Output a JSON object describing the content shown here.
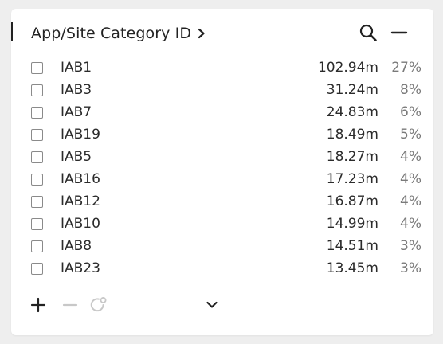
{
  "widget": {
    "title": "App/Site Category ID",
    "title_icon": "chevron-right-icon",
    "search_icon": "search-icon",
    "minimize_icon": "minus-icon"
  },
  "rows": [
    {
      "name": "IAB1",
      "value": "102.94m",
      "pct": "27%"
    },
    {
      "name": "IAB3",
      "value": "31.24m",
      "pct": "8%"
    },
    {
      "name": "IAB7",
      "value": "24.83m",
      "pct": "6%"
    },
    {
      "name": "IAB19",
      "value": "18.49m",
      "pct": "5%"
    },
    {
      "name": "IAB5",
      "value": "18.27m",
      "pct": "4%"
    },
    {
      "name": "IAB16",
      "value": "17.23m",
      "pct": "4%"
    },
    {
      "name": "IAB12",
      "value": "16.87m",
      "pct": "4%"
    },
    {
      "name": "IAB10",
      "value": "14.99m",
      "pct": "4%"
    },
    {
      "name": "IAB8",
      "value": "14.51m",
      "pct": "3%"
    },
    {
      "name": "IAB23",
      "value": "13.45m",
      "pct": "3%"
    }
  ],
  "footer": {
    "add_icon": "plus-icon",
    "remove_icon": "minus-icon",
    "reset_icon": "reset-icon",
    "expand_icon": "chevron-down-icon"
  },
  "colors": {
    "text": "#222222",
    "muted": "#7a7a7a",
    "disabled": "#c8c8c8",
    "checkbox_border": "#8a8a8a"
  }
}
